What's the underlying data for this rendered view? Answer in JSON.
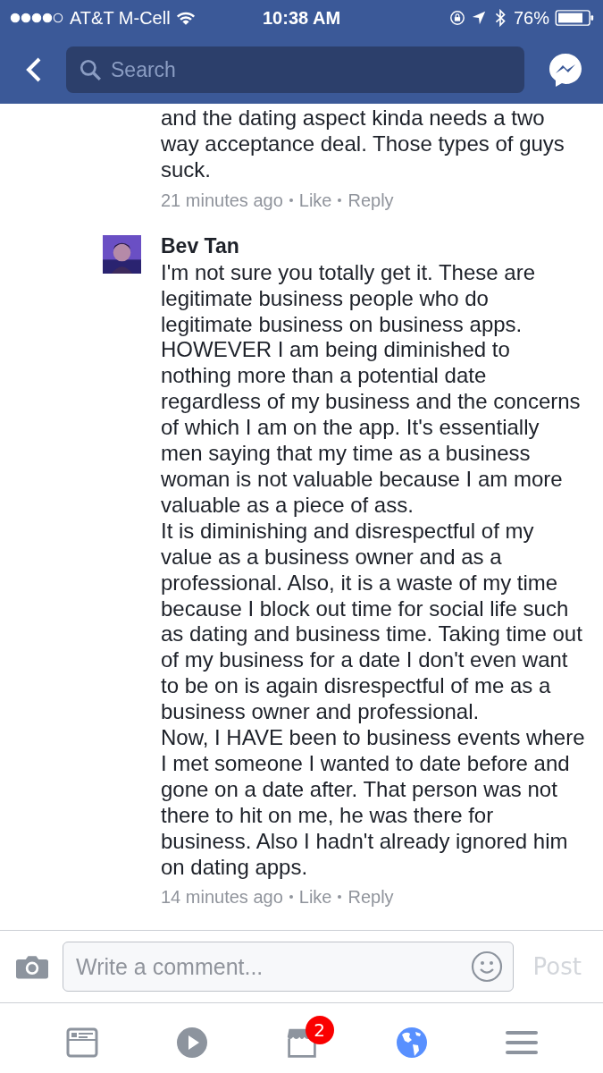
{
  "status_bar": {
    "carrier": "AT&T M-Cell",
    "time": "10:38 AM",
    "battery": "76%"
  },
  "header": {
    "search": {
      "placeholder": "Search"
    }
  },
  "comments": [
    {
      "paragraphs": [
        "and the dating aspect kinda needs a two way acceptance deal. Those types of guys suck."
      ],
      "time": "21 minutes ago",
      "actions": [
        "Like",
        "Reply"
      ]
    },
    {
      "author": "Bev Tan",
      "avatar": true,
      "paragraphs": [
        "I'm not sure you totally get it. These are legitimate business people who do legitimate business on business apps. HOWEVER I am being diminished to nothing more than a potential date regardless of my business and the concerns of which I am on the app. It's essentially men saying that my time as a business woman is not valuable because I am more valuable as a piece of ass.",
        "It is diminishing and disrespectful of my value as a business owner and as a professional. Also, it is a waste of my time because I block out time for social life such as dating and business time. Taking time out of my business for a date I don't even want to be on is again disrespectful of me as a business owner and professional.",
        "Now, I HAVE been to business events where I met someone I wanted to date before and gone on a date after. That person was not there to hit on me, he was there for business. Also I hadn't already ignored him on dating apps."
      ],
      "time": "14 minutes ago",
      "actions": [
        "Like",
        "Reply"
      ]
    }
  ],
  "composer": {
    "placeholder": "Write a comment...",
    "post": "Post",
    "post_disabled": true
  },
  "tabs": [
    {
      "kind": "feed",
      "selected": false
    },
    {
      "kind": "video",
      "selected": false
    },
    {
      "kind": "marketplace",
      "selected": false,
      "badge": "2"
    },
    {
      "kind": "notifications",
      "selected": true
    },
    {
      "kind": "menu",
      "selected": false
    }
  ]
}
